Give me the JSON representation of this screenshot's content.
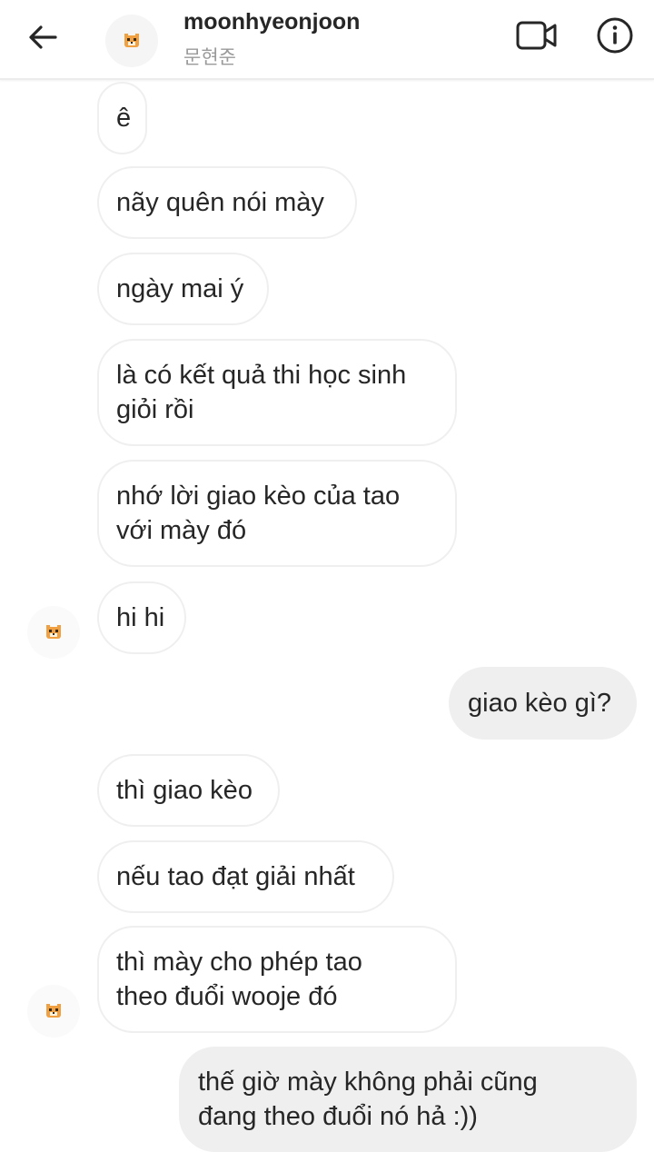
{
  "header": {
    "username": "moonhyeonjoon",
    "subtitle": "문현준",
    "back_icon": "back-arrow-icon",
    "video_icon": "video-call-icon",
    "info_icon": "info-icon"
  },
  "messages": [
    {
      "side": "in",
      "text": "ê"
    },
    {
      "side": "in",
      "text": "nãy quên nói mày"
    },
    {
      "side": "in",
      "text": "ngày mai ý"
    },
    {
      "side": "in",
      "text": "là có kết quả thi học sinh\ngiỏi rồi"
    },
    {
      "side": "in",
      "text": "nhớ lời giao kèo của tao\nvới mày đó"
    },
    {
      "side": "in",
      "text": "hi hi"
    },
    {
      "side": "out",
      "text": "giao kèo gì?"
    },
    {
      "side": "in",
      "text": "thì giao kèo"
    },
    {
      "side": "in",
      "text": "nếu tao đạt giải nhất"
    },
    {
      "side": "in",
      "text": "thì mày cho phép tao\ntheo đuổi wooje đó"
    },
    {
      "side": "out",
      "text": "thế giờ mày không phải cũng\nđang theo đuổi nó hả :))"
    }
  ],
  "colors": {
    "incoming_border": "#efefef",
    "outgoing_bg": "#efefef",
    "text": "#262626",
    "subtitle": "#9a9a9a"
  }
}
